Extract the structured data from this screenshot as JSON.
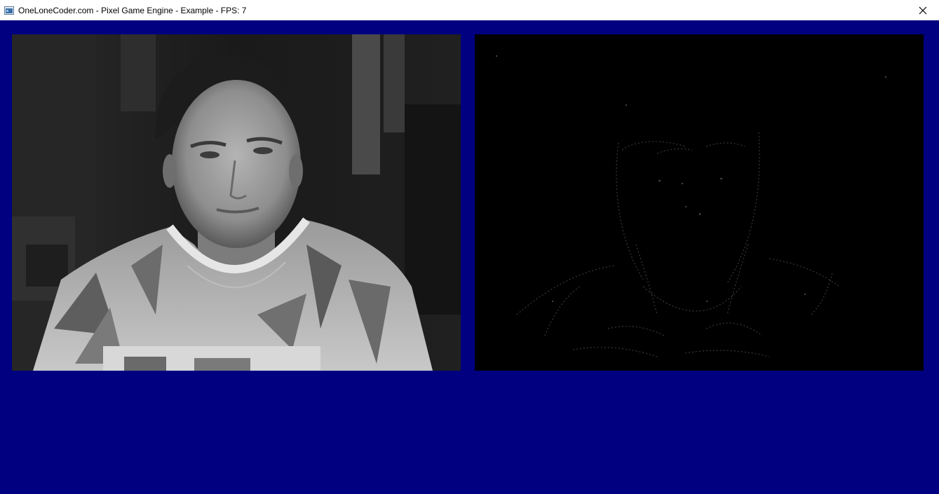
{
  "window": {
    "title": "OneLoneCoder.com - Pixel Game Engine - Example - FPS: 7",
    "icon": "app-window-icon",
    "close_icon": "close-icon"
  },
  "canvas": {
    "background": "#000080"
  },
  "views": {
    "left": {
      "content": "webcam grayscale frame"
    },
    "right": {
      "content": "edge detection frame"
    }
  }
}
